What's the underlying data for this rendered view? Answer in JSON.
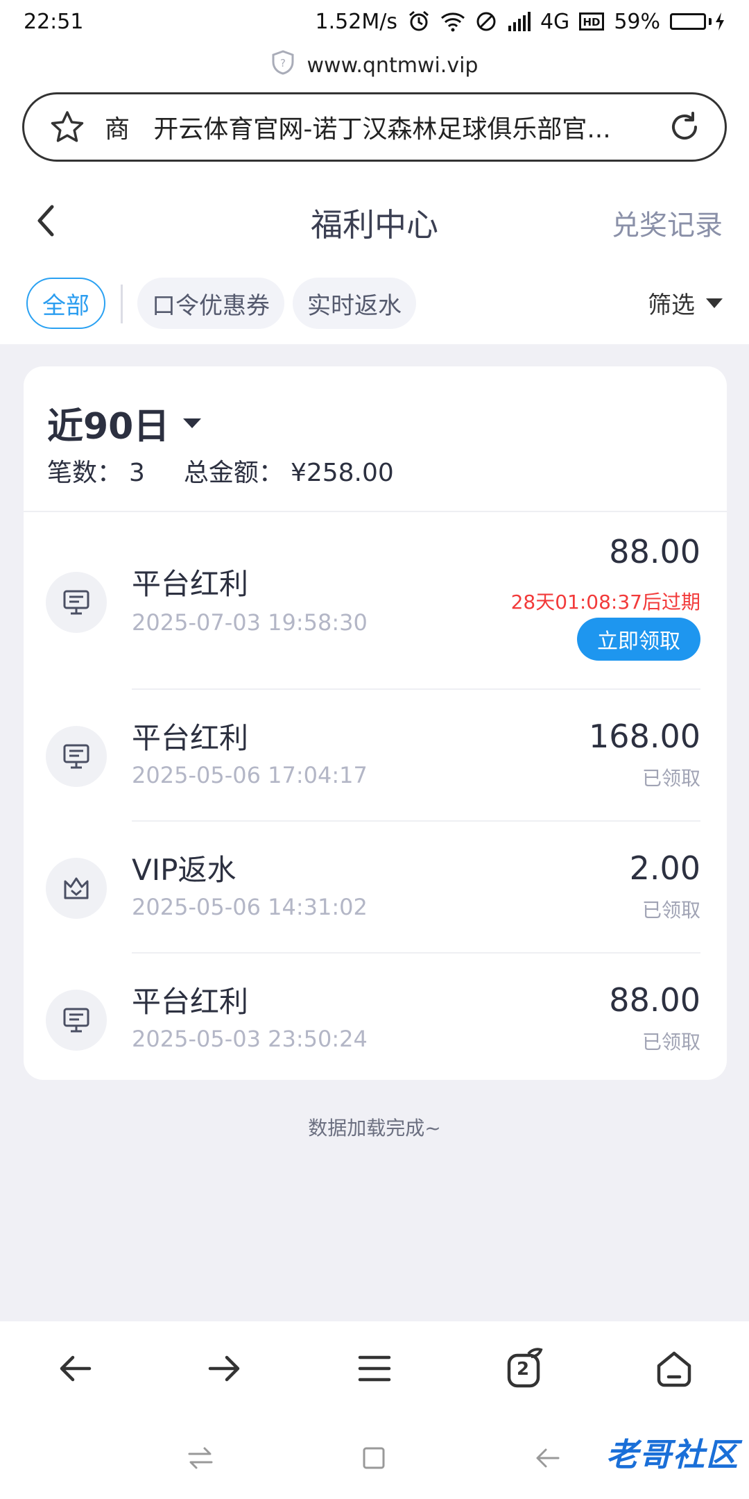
{
  "status_bar": {
    "time": "22:51",
    "speed": "1.52M/s",
    "network": "4G",
    "battery": "59%",
    "battery_level": 0.59
  },
  "browser": {
    "domain": "www.qntmwi.vip",
    "address_prefix": "商",
    "page_title": "开云体育官网-诺丁汉森林足球俱乐部官..."
  },
  "header": {
    "title": "福利中心",
    "records": "兑奖记录"
  },
  "tabs": {
    "items": [
      "全部",
      "口令优惠券",
      "实时返水"
    ],
    "filter": "筛选"
  },
  "summary": {
    "range": "近90日",
    "count_label": "笔数：",
    "count": "3",
    "total_label": "总金额：",
    "total": "¥258.00"
  },
  "records": [
    {
      "icon": "monitor-icon",
      "name": "平台红利",
      "date": "2025-07-03 19:58:30",
      "amount": "88.00",
      "expire": "28天01:08:37后过期",
      "action": "立即领取"
    },
    {
      "icon": "monitor-icon",
      "name": "平台红利",
      "date": "2025-05-06 17:04:17",
      "amount": "168.00",
      "status": "已领取"
    },
    {
      "icon": "crown-icon",
      "name": "VIP返水",
      "date": "2025-05-06 14:31:02",
      "amount": "2.00",
      "status": "已领取"
    },
    {
      "icon": "monitor-icon",
      "name": "平台红利",
      "date": "2025-05-03 23:50:24",
      "amount": "88.00",
      "status": "已领取"
    }
  ],
  "footer": {
    "loaded": "数据加载完成~"
  },
  "browser_nav": {
    "tab_count": "2"
  },
  "watermark": "老哥社区",
  "colors": {
    "accent": "#1e96ef",
    "expire": "#f23a3a",
    "background": "#f0f0f5"
  }
}
